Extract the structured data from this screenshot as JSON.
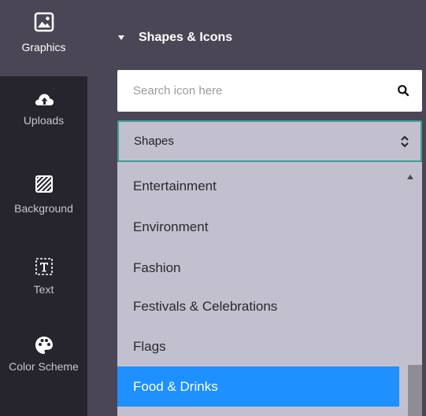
{
  "rail": {
    "items": [
      {
        "label": "Graphics",
        "icon": "image-icon",
        "active": true
      },
      {
        "label": "Uploads",
        "icon": "cloud-upload-icon"
      },
      {
        "label": "Background",
        "icon": "background-pattern-icon"
      },
      {
        "label": "Text",
        "icon": "text-icon"
      },
      {
        "label": "Color Scheme",
        "icon": "palette-icon"
      }
    ]
  },
  "panel": {
    "title": "Shapes & Icons",
    "search": {
      "placeholder": "Search icon here",
      "value": ""
    },
    "category_select": {
      "selected": "Shapes"
    },
    "dropdown": {
      "options": [
        "Entertainment",
        "Environment",
        "Fashion",
        "Festivals & Celebrations",
        "Flags",
        "Food & Drinks"
      ],
      "highlighted": "Food & Drinks"
    }
  },
  "colors": {
    "rail_bg": "#26242d",
    "panel_bg": "#4a4655",
    "dropdown_bg": "#c2bfce",
    "select_border": "#3f9e9a",
    "highlight": "#1e90ff"
  }
}
